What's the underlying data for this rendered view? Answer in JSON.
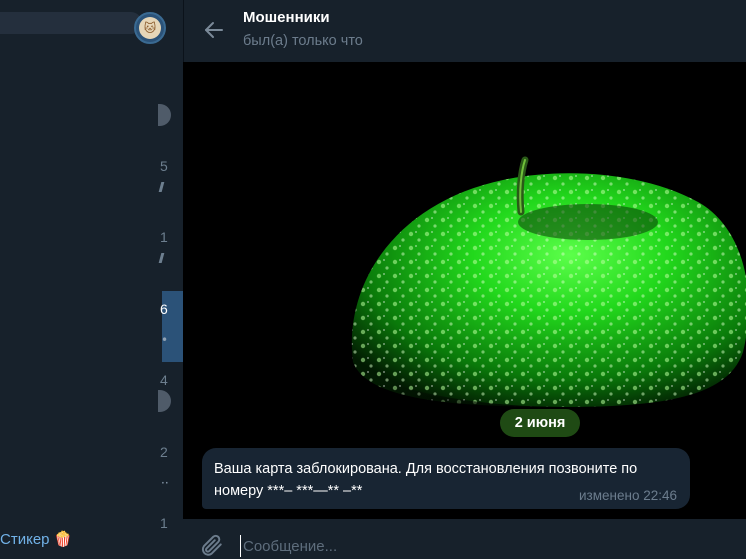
{
  "header": {
    "title": "Мошенники",
    "status": "был(а) только что"
  },
  "sidebar": {
    "items": [
      {
        "time": "",
        "indicator": "badge"
      },
      {
        "time": "5",
        "indicator": "pin"
      },
      {
        "time": "1",
        "indicator": "pin"
      },
      {
        "time": "6",
        "indicator": "dot",
        "active": true
      },
      {
        "time": "4",
        "indicator": "badge"
      },
      {
        "time": "2",
        "indicator": "dots"
      },
      {
        "time": "1",
        "indicator": "none"
      }
    ],
    "footer_text": "Стикер",
    "footer_emoji": "🍿"
  },
  "messages": {
    "date_label": "2 июня",
    "items": [
      {
        "text": "Ваша карта заблокирована. Для восстановления позвоните по номеру ***– ***—** –**",
        "meta": "изменено 22:46"
      }
    ]
  },
  "input": {
    "placeholder": "Сообщение..."
  },
  "colors": {
    "background": "#0e1621",
    "panel": "#17212b",
    "bubble": "#182533",
    "accent": "#2b5278",
    "date_pill": "#1f4a14"
  },
  "icons": {
    "back": "arrow-left-icon",
    "attach": "paperclip-icon"
  }
}
